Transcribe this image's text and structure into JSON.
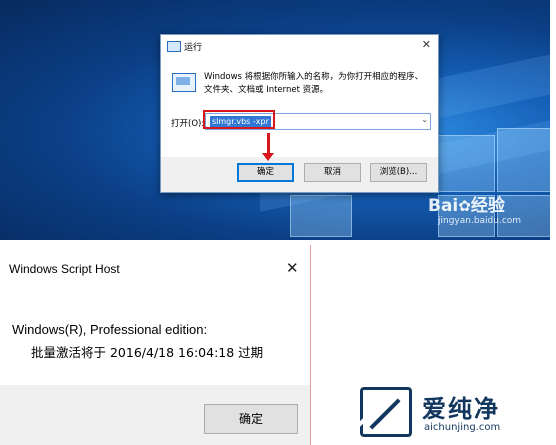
{
  "run_dialog": {
    "title": "运行",
    "close": "✕",
    "description_line1": "Windows 将根据你所输入的名称，为你打开相应的程序、",
    "description_line2": "文件夹、文档或 Internet 资源。",
    "open_label": "打开(O):",
    "input_value": "slmgr.vbs -xpr",
    "dropdown_glyph": "⌄",
    "ok_label": "确定",
    "cancel_label": "取消",
    "browse_label": "浏览(B)..."
  },
  "watermark_top": {
    "brand": "Bai",
    "brand_suffix": "经验",
    "url": "jingyan.baidu.com"
  },
  "wsh_dialog": {
    "title": "Windows Script Host",
    "close": "✕",
    "line1": "Windows(R), Professional edition:",
    "line2": "批量激活将于 2016/4/18 16:04:18 过期",
    "ok_label": "确定"
  },
  "watermark_bottom": {
    "cn": "爱纯净",
    "url": "aichunjing.com"
  },
  "colors": {
    "highlight_red": "#d9141b",
    "desktop_blue": "#1560b8",
    "watermark_navy": "#12375e"
  }
}
